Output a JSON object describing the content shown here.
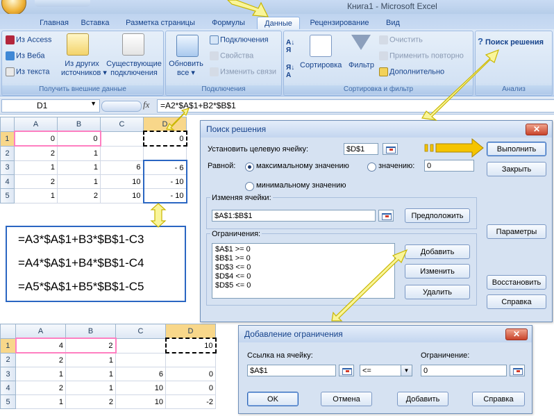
{
  "window": {
    "title": "Книга1 - Microsoft Excel"
  },
  "tabs": [
    {
      "label": "Главная"
    },
    {
      "label": "Вставка"
    },
    {
      "label": "Разметка страницы"
    },
    {
      "label": "Формулы"
    },
    {
      "label": "Данные"
    },
    {
      "label": "Рецензирование"
    },
    {
      "label": "Вид"
    }
  ],
  "ribbon": {
    "external": {
      "group_label": "Получить внешние данные",
      "from_access": "Из Access",
      "from_web": "Из Веба",
      "from_text": "Из текста",
      "other_sources_1": "Из других",
      "other_sources_2": "источников",
      "existing_1": "Существующие",
      "existing_2": "подключения"
    },
    "connections": {
      "group_label": "Подключения",
      "refresh_1": "Обновить",
      "refresh_2": "все",
      "connections": "Подключения",
      "properties": "Свойства",
      "edit_links": "Изменить связи"
    },
    "sort": {
      "group_label": "Сортировка и фильтр",
      "sort": "Сортировка",
      "filter": "Фильтр",
      "clear": "Очистить",
      "reapply": "Применить повторно",
      "advanced": "Дополнительно"
    },
    "analysis": {
      "group_label": "Анализ",
      "solver": "Поиск решения"
    }
  },
  "formula_bar": {
    "name_box": "D1",
    "fx": "fx",
    "formula": "=A2*$A$1+B2*$B$1"
  },
  "sheet1": {
    "columns": [
      "A",
      "B",
      "C",
      "D"
    ],
    "rows": [
      {
        "num": "1",
        "cells": [
          "0",
          "0",
          "",
          "0"
        ]
      },
      {
        "num": "2",
        "cells": [
          "2",
          "1",
          "",
          ""
        ]
      },
      {
        "num": "3",
        "cells": [
          "1",
          "1",
          "6",
          "- 6"
        ]
      },
      {
        "num": "4",
        "cells": [
          "2",
          "1",
          "10",
          "- 10"
        ]
      },
      {
        "num": "5",
        "cells": [
          "1",
          "2",
          "10",
          "- 10"
        ]
      }
    ]
  },
  "formulas_box": {
    "lines": [
      "=A3*$A$1+B3*$B$1-C3",
      "=A4*$A$1+B4*$B$1-C4",
      "=A5*$A$1+B5*$B$1-C5"
    ]
  },
  "sheet2": {
    "columns": [
      "A",
      "B",
      "C",
      "D"
    ],
    "rows": [
      {
        "num": "1",
        "cells": [
          "4",
          "2",
          "",
          "10"
        ]
      },
      {
        "num": "2",
        "cells": [
          "2",
          "1",
          "",
          ""
        ]
      },
      {
        "num": "3",
        "cells": [
          "1",
          "1",
          "6",
          "0"
        ]
      },
      {
        "num": "4",
        "cells": [
          "2",
          "1",
          "10",
          "0"
        ]
      },
      {
        "num": "5",
        "cells": [
          "1",
          "2",
          "10",
          "-2"
        ]
      }
    ]
  },
  "solver_dialog": {
    "title": "Поиск решения",
    "target_label": "Установить целевую ячейку:",
    "target_value": "$D$1",
    "equal_label": "Равной:",
    "max_label": "максимальному значению",
    "value_label": "значению:",
    "value_input": "0",
    "min_label": "минимальному значению",
    "changing_label": "Изменяя ячейки:",
    "changing_value": "$A$1:$B$1",
    "guess_button": "Предположить",
    "constraints_label": "Ограничения:",
    "constraints": [
      "$A$1 >= 0",
      "$B$1 >= 0",
      "$D$3 <= 0",
      "$D$4 <= 0",
      "$D$5 <= 0"
    ],
    "solve_button": "Выполнить",
    "close_button": "Закрыть",
    "options_button": "Параметры",
    "add_button": "Добавить",
    "change_button": "Изменить",
    "delete_button": "Удалить",
    "reset_button": "Восстановить",
    "help_button": "Справка"
  },
  "constraint_dialog": {
    "title": "Добавление ограничения",
    "ref_label": "Ссылка на ячейку:",
    "ref_value": "$A$1",
    "operator": "<=",
    "constraint_label": "Ограничение:",
    "constraint_value": "0",
    "ok_button": "OK",
    "cancel_button": "Отмена",
    "add_button": "Добавить",
    "help_button": "Справка"
  },
  "colors": {
    "arrow_fill": "#f9f59a",
    "arrow_stroke": "#c9b600",
    "solve_arrow": "#f5c400",
    "formula_box_border": "#2a66c2",
    "selected_row_border": "#ff7fc1"
  }
}
